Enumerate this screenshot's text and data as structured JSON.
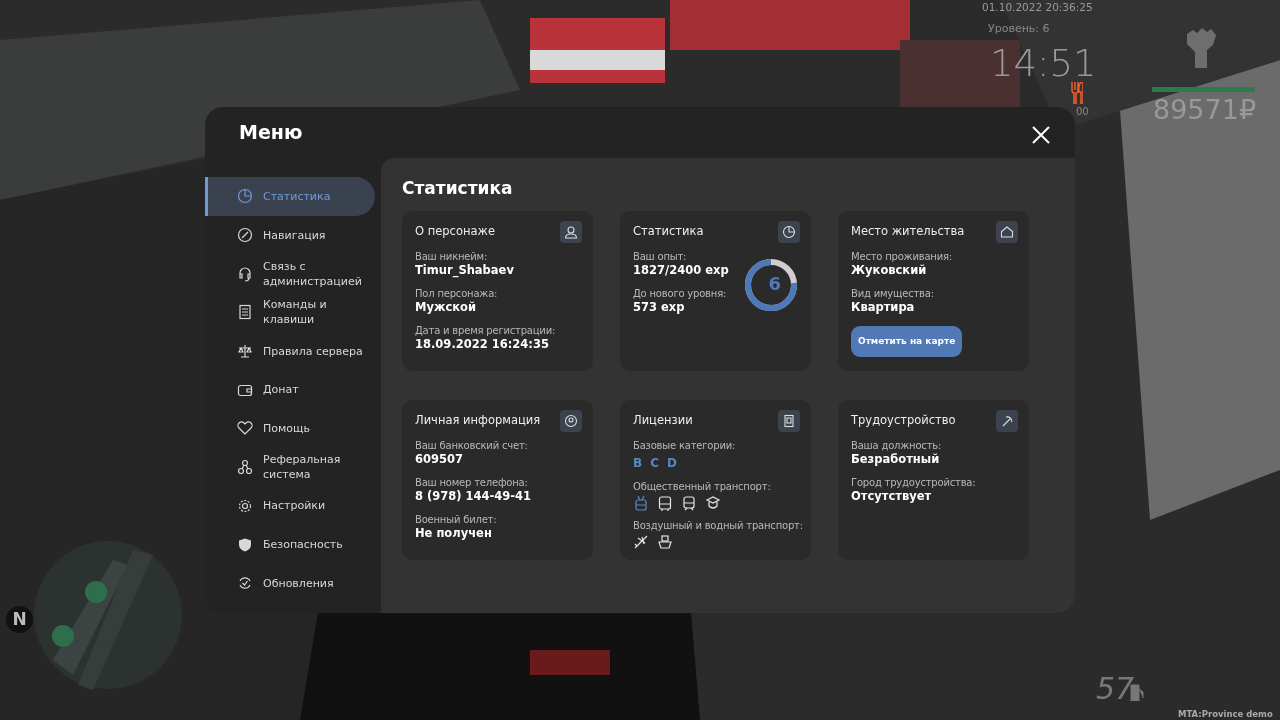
{
  "hud": {
    "datetime": "01.10.2022 20:36:25",
    "level": "Уровень: 6",
    "clock": "14:51",
    "hunger": "00",
    "money": "89571₽",
    "speed": "57",
    "version": "MTA:Province demo",
    "compass": "N"
  },
  "menu": {
    "title": "Меню",
    "sidebar": [
      {
        "label": "Статистика",
        "selected": true
      },
      {
        "label": "Навигация",
        "selected": false
      },
      {
        "label": "Связь с администрацией",
        "selected": false
      },
      {
        "label": "Команды и клавиши",
        "selected": false
      },
      {
        "label": "Правила сервера",
        "selected": false
      },
      {
        "label": "Донат",
        "selected": false
      },
      {
        "label": "Помощь",
        "selected": false
      },
      {
        "label": "Реферальная система",
        "selected": false
      },
      {
        "label": "Настройки",
        "selected": false
      },
      {
        "label": "Безопасность",
        "selected": false
      },
      {
        "label": "Обновления",
        "selected": false
      }
    ],
    "heading": "Статистика",
    "cards": [
      {
        "kind": "fields",
        "title": "О персонаже",
        "fields": [
          {
            "label": "Ваш никнейм:",
            "value": "Timur_Shabaev"
          },
          {
            "label": "Пол персонажа:",
            "value": "Мужской"
          },
          {
            "label": "Дата и время регистрации:",
            "value": "18.09.2022 16:24:35"
          }
        ]
      },
      {
        "kind": "experience",
        "title": "Статистика",
        "fields": [
          {
            "label": "Ваш опыт:",
            "value": "1827/2400 exp"
          },
          {
            "label": "До нового уровня:",
            "value": "573 exp"
          }
        ],
        "ring": {
          "level": 0.76,
          "text": "6"
        }
      },
      {
        "kind": "residence",
        "title": "Место жительства",
        "fields": [
          {
            "label": "Место проживания:",
            "value": "Жуковский"
          },
          {
            "label": "Вид имущества:",
            "value": "Квартира"
          }
        ],
        "button": "Отметить на карте"
      },
      {
        "kind": "fields",
        "title": "Личная информация",
        "fields": [
          {
            "label": "Ваш банковский счет:",
            "value": "609507"
          },
          {
            "label": "Ваш номер телефона:",
            "value": "8 (978) 144-49-41"
          },
          {
            "label": "Военный билет:",
            "value": "Не получен"
          }
        ]
      },
      {
        "kind": "licenses",
        "title": "Лицензии",
        "categories_label": "Базовые категории:",
        "categories": [
          {
            "letter": "B",
            "owned": true
          },
          {
            "letter": "C",
            "owned": true
          },
          {
            "letter": "D",
            "owned": true
          }
        ],
        "public_label": "Общественный транспорт:",
        "public": [
          {
            "kind": "trolleybus",
            "owned": true
          },
          {
            "kind": "bus",
            "owned": false
          },
          {
            "kind": "train",
            "owned": false
          },
          {
            "kind": "conductor",
            "owned": false
          }
        ],
        "air_label": "Воздушный и водный транспорт:",
        "air": [
          {
            "kind": "plane",
            "owned": false
          },
          {
            "kind": "ship",
            "owned": false
          }
        ]
      },
      {
        "kind": "fields",
        "title": "Трудоустройство",
        "fields": [
          {
            "label": "Ваша должность:",
            "value": "Безработный"
          },
          {
            "label": "Город трудоустройства:",
            "value": "Отсутствует"
          }
        ]
      }
    ]
  }
}
